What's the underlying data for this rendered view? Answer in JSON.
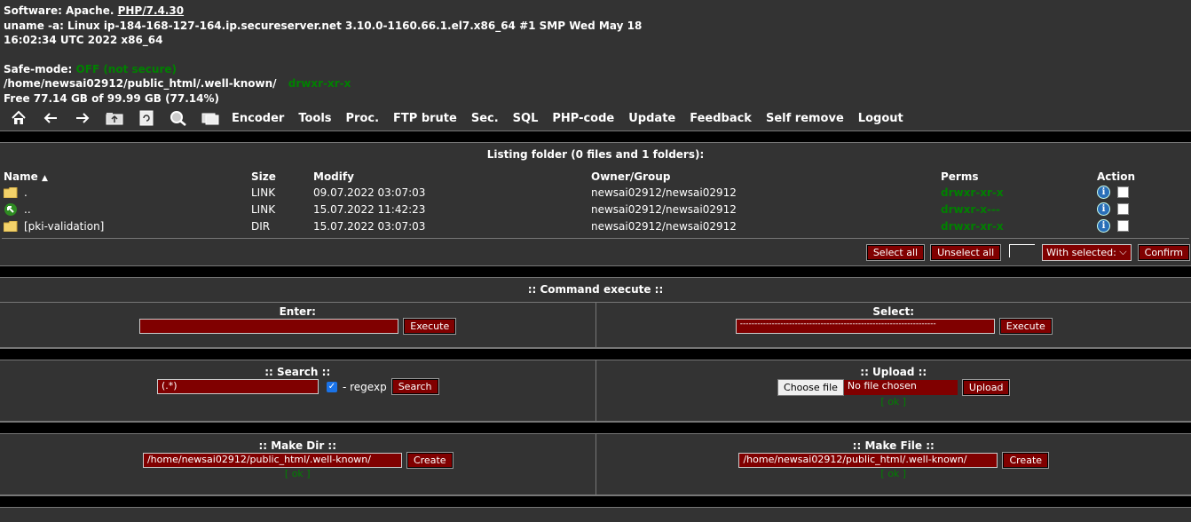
{
  "info": {
    "software_label": "Software: Apache.",
    "software_php": "PHP/7.4.30",
    "uname_line1": "uname -a: Linux ip-184-168-127-164.ip.secureserver.net 3.10.0-1160.66.1.el7.x86_64 #1 SMP Wed May 18",
    "uname_line2": "16:02:34 UTC 2022 x86_64",
    "safemode_label": "Safe-mode:",
    "safemode_value": "OFF (not secure)",
    "path": "/home/newsai02912/public_html/.well-known/",
    "path_perms": "drwxr-xr-x",
    "free": "Free 77.14 GB of 99.99 GB (77.14%)"
  },
  "toolbar": {
    "icons": [
      "home-icon",
      "back-icon",
      "forward-icon",
      "up-folder-icon",
      "refresh-icon",
      "search-icon",
      "buffer-icon"
    ],
    "menu": [
      "Encoder",
      "Tools",
      "Proc.",
      "FTP brute",
      "Sec.",
      "SQL",
      "PHP-code",
      "Update",
      "Feedback",
      "Self remove",
      "Logout"
    ]
  },
  "listing": {
    "title": "Listing folder (0 files and 1 folders):",
    "headers": {
      "name": "Name",
      "sort_arrow": "▲",
      "size": "Size",
      "modify": "Modify",
      "owner": "Owner/Group",
      "perms": "Perms",
      "action": "Action"
    },
    "rows": [
      {
        "name": ".",
        "size": "LINK",
        "modify": "09.07.2022 03:07:03",
        "owner": "newsai02912/newsai02912",
        "perms": "drwxr-xr-x",
        "icon": "folder-icon"
      },
      {
        "name": "..",
        "size": "LINK",
        "modify": "15.07.2022 11:42:23",
        "owner": "newsai02912/newsai02912",
        "perms": "drwxr-x---",
        "icon": "back-arrow-icon"
      },
      {
        "name": "[pki-validation]",
        "size": "DIR",
        "modify": "15.07.2022 03:07:03",
        "owner": "newsai02912/newsai02912",
        "perms": "drwxr-xr-x",
        "icon": "folder-icon"
      }
    ],
    "select_all": "Select all",
    "unselect_all": "Unselect all",
    "with_selected": "With selected:",
    "confirm": "Confirm"
  },
  "command": {
    "title": ":: Command execute ::",
    "enter_label": "Enter:",
    "enter_value": "",
    "execute": "Execute",
    "select_label": "Select:",
    "select_value": "--------------------------------------------------------------------"
  },
  "search": {
    "title": ":: Search ::",
    "value": "(.*)",
    "regexp_label": "- regexp",
    "button": "Search"
  },
  "upload": {
    "title": ":: Upload ::",
    "choose": "Choose file",
    "no_file": "No file chosen",
    "button": "Upload",
    "ok": "[ ok ]"
  },
  "makedir": {
    "title": ":: Make Dir ::",
    "value": "/home/newsai02912/public_html/.well-known/",
    "button": "Create",
    "ok": "[ ok ]"
  },
  "makefile": {
    "title": ":: Make File ::",
    "value": "/home/newsai02912/public_html/.well-known/",
    "button": "Create",
    "ok": "[ ok ]"
  }
}
